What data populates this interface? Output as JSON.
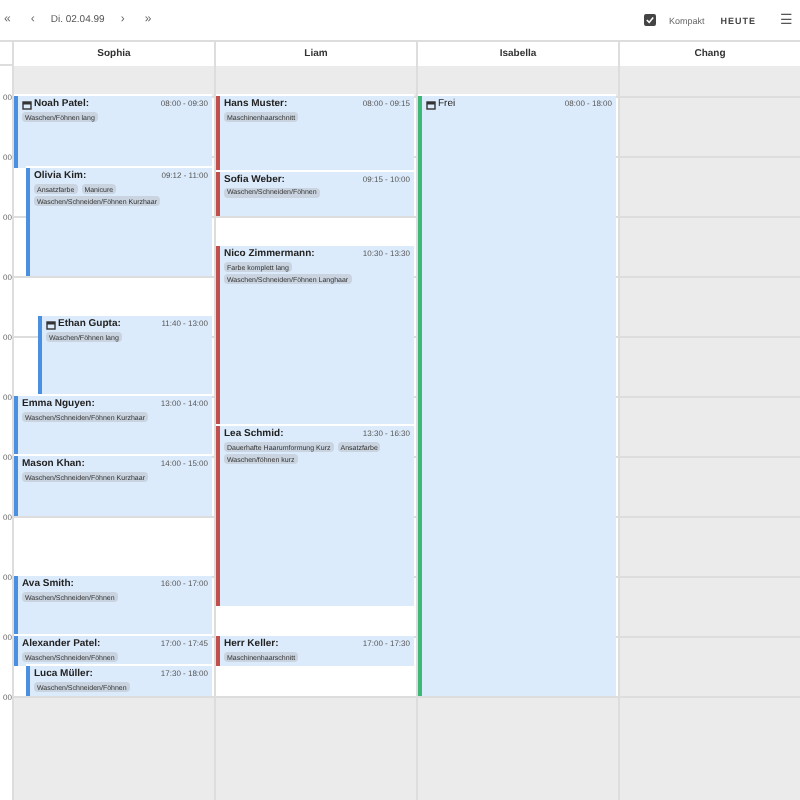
{
  "toolbar": {
    "nav": [
      "«",
      "‹"
    ],
    "date": "Di. 02.04.99",
    "nav_after": [
      "›",
      "»"
    ],
    "compact": {
      "label": "Kompakt",
      "checked": true
    },
    "today_button": "HEUTE",
    "menu": "☰"
  },
  "hour_labels": [
    "00",
    "00",
    "00",
    "00",
    "00",
    "00",
    "00",
    "00",
    "00",
    "00",
    "00"
  ],
  "columns": [
    {
      "name": "Sophia",
      "available": true,
      "color": "#4a8fe0",
      "events": [
        {
          "kind": "appointment",
          "name": "Noah Patel:",
          "time": "08:00 - 09:30",
          "calendar_icon": true,
          "services": [
            "Waschen/Föhnen lang"
          ],
          "children": [
            {
              "kind": "appointment",
              "name": "Olivia Kim:",
              "time": "09:12 - 11:00",
              "calendar_icon": false,
              "services": [
                "Ansatzfarbe",
                "Manicure",
                "Waschen/Schneiden/Föhnen Kurzhaar"
              ],
              "children": [
                {
                  "kind": "appointment",
                  "name": "Ethan Gupta:",
                  "time": "11:40 - 13:00",
                  "calendar_icon": true,
                  "services": [
                    "Waschen/Föhnen lang"
                  ]
                }
              ]
            }
          ]
        },
        {
          "kind": "appointment",
          "name": "Emma Nguyen:",
          "time": "13:00 - 14:00",
          "calendar_icon": false,
          "services": [
            "Waschen/Schneiden/Föhnen Kurzhaar"
          ]
        },
        {
          "kind": "appointment",
          "name": "Mason Khan:",
          "time": "14:00 - 15:00",
          "calendar_icon": false,
          "services": [
            "Waschen/Schneiden/Föhnen Kurzhaar"
          ]
        },
        {
          "kind": "appointment",
          "name": "Ava Smith:",
          "time": "16:00 - 17:00",
          "calendar_icon": false,
          "services": [
            "Waschen/Schneiden/Föhnen"
          ]
        },
        {
          "kind": "appointment",
          "name": "Alexander Patel:",
          "time": "17:00 - 17:45",
          "calendar_icon": false,
          "services": [
            "Waschen/Schneiden/Föhnen"
          ],
          "children": [
            {
              "kind": "appointment",
              "name": "Luca Müller:",
              "time": "17:30 - 18:00",
              "calendar_icon": false,
              "services": [
                "Waschen/Schneiden/Föhnen"
              ]
            }
          ]
        }
      ]
    },
    {
      "name": "Liam",
      "available": true,
      "color": "#c0504d",
      "events": [
        {
          "kind": "appointment",
          "name": "Hans Muster:",
          "time": "08:00 - 09:15",
          "calendar_icon": false,
          "services": [
            "Maschinenhaarschnitt"
          ]
        },
        {
          "kind": "appointment",
          "name": "Sofia Weber:",
          "time": "09:15 - 10:00",
          "calendar_icon": false,
          "services": [
            "Waschen/Schneiden/Föhnen"
          ]
        },
        {
          "kind": "appointment",
          "name": "Nico Zimmermann:",
          "time": "10:30 - 13:30",
          "calendar_icon": false,
          "services": [
            "Farbe komplett lang",
            "Waschen/Schneiden/Föhnen Langhaar"
          ]
        },
        {
          "kind": "appointment",
          "name": "Lea Schmid:",
          "time": "13:30 - 16:30",
          "calendar_icon": false,
          "services": [
            "Dauerhafte Haarumformung Kurz",
            "Ansatzfarbe",
            "Waschen/föhnen kurz"
          ]
        },
        {
          "kind": "appointment",
          "name": "Herr Keller:",
          "time": "17:00 - 17:30",
          "calendar_icon": false,
          "services": [
            "Maschinenhaarschnitt"
          ]
        }
      ]
    },
    {
      "name": "Isabella",
      "available": true,
      "color": "#3cb878",
      "events": [
        {
          "kind": "block",
          "name": "Frei",
          "time": "08:00 - 18:00",
          "calendar_icon": true
        }
      ]
    },
    {
      "name": "Chang",
      "available": false
    }
  ]
}
